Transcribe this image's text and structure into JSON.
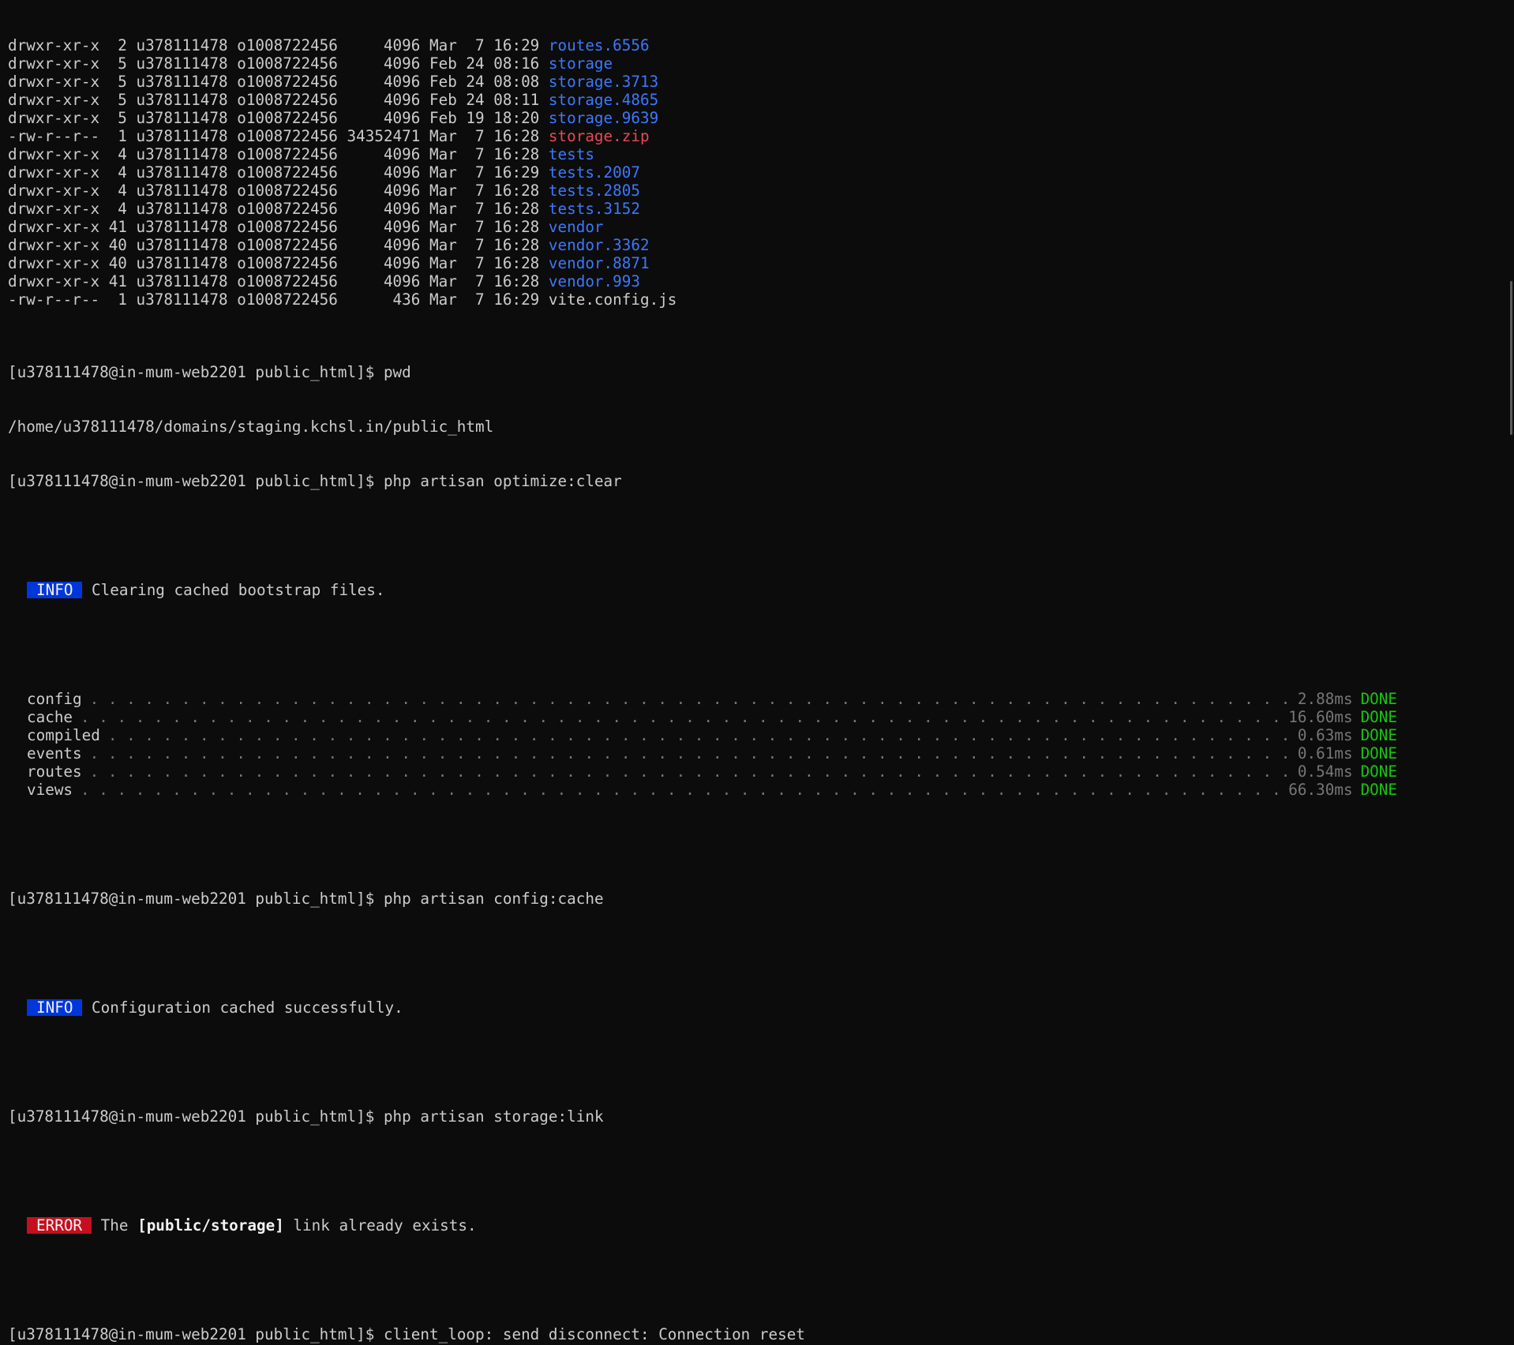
{
  "listing": [
    {
      "perms": "drwxr-xr-x",
      "links": " 2",
      "owner": "u378111478",
      "group": "o1008722456",
      "size": "    4096",
      "date": "Mar  7 16:29",
      "name": "routes.6556",
      "kind": "dir"
    },
    {
      "perms": "drwxr-xr-x",
      "links": " 5",
      "owner": "u378111478",
      "group": "o1008722456",
      "size": "    4096",
      "date": "Feb 24 08:16",
      "name": "storage",
      "kind": "dir"
    },
    {
      "perms": "drwxr-xr-x",
      "links": " 5",
      "owner": "u378111478",
      "group": "o1008722456",
      "size": "    4096",
      "date": "Feb 24 08:08",
      "name": "storage.3713",
      "kind": "dir"
    },
    {
      "perms": "drwxr-xr-x",
      "links": " 5",
      "owner": "u378111478",
      "group": "o1008722456",
      "size": "    4096",
      "date": "Feb 24 08:11",
      "name": "storage.4865",
      "kind": "dir"
    },
    {
      "perms": "drwxr-xr-x",
      "links": " 5",
      "owner": "u378111478",
      "group": "o1008722456",
      "size": "    4096",
      "date": "Feb 19 18:20",
      "name": "storage.9639",
      "kind": "dir"
    },
    {
      "perms": "-rw-r--r--",
      "links": " 1",
      "owner": "u378111478",
      "group": "o1008722456",
      "size": "34352471",
      "date": "Mar  7 16:28",
      "name": "storage.zip",
      "kind": "zip"
    },
    {
      "perms": "drwxr-xr-x",
      "links": " 4",
      "owner": "u378111478",
      "group": "o1008722456",
      "size": "    4096",
      "date": "Mar  7 16:28",
      "name": "tests",
      "kind": "dir"
    },
    {
      "perms": "drwxr-xr-x",
      "links": " 4",
      "owner": "u378111478",
      "group": "o1008722456",
      "size": "    4096",
      "date": "Mar  7 16:29",
      "name": "tests.2007",
      "kind": "dir"
    },
    {
      "perms": "drwxr-xr-x",
      "links": " 4",
      "owner": "u378111478",
      "group": "o1008722456",
      "size": "    4096",
      "date": "Mar  7 16:28",
      "name": "tests.2805",
      "kind": "dir"
    },
    {
      "perms": "drwxr-xr-x",
      "links": " 4",
      "owner": "u378111478",
      "group": "o1008722456",
      "size": "    4096",
      "date": "Mar  7 16:28",
      "name": "tests.3152",
      "kind": "dir"
    },
    {
      "perms": "drwxr-xr-x",
      "links": "41",
      "owner": "u378111478",
      "group": "o1008722456",
      "size": "    4096",
      "date": "Mar  7 16:28",
      "name": "vendor",
      "kind": "dir"
    },
    {
      "perms": "drwxr-xr-x",
      "links": "40",
      "owner": "u378111478",
      "group": "o1008722456",
      "size": "    4096",
      "date": "Mar  7 16:28",
      "name": "vendor.3362",
      "kind": "dir"
    },
    {
      "perms": "drwxr-xr-x",
      "links": "40",
      "owner": "u378111478",
      "group": "o1008722456",
      "size": "    4096",
      "date": "Mar  7 16:28",
      "name": "vendor.8871",
      "kind": "dir"
    },
    {
      "perms": "drwxr-xr-x",
      "links": "41",
      "owner": "u378111478",
      "group": "o1008722456",
      "size": "    4096",
      "date": "Mar  7 16:28",
      "name": "vendor.993",
      "kind": "dir"
    },
    {
      "perms": "-rw-r--r--",
      "links": " 1",
      "owner": "u378111478",
      "group": "o1008722456",
      "size": "     436",
      "date": "Mar  7 16:29",
      "name": "vite.config.js",
      "kind": "plain"
    }
  ],
  "prompt": "[u378111478@in-mum-web2201 public_html]$ ",
  "cmd_pwd": "pwd",
  "pwd_output": "/home/u378111478/domains/staging.kchsl.in/public_html",
  "cmd_optimize": "php artisan optimize:clear",
  "info_label": "INFO",
  "optimize_msg": "Clearing cached bootstrap files.",
  "tasks": [
    {
      "name": "config",
      "time": "2.88ms",
      "status": "DONE"
    },
    {
      "name": "cache",
      "time": "16.60ms",
      "status": "DONE"
    },
    {
      "name": "compiled",
      "time": "0.63ms",
      "status": "DONE"
    },
    {
      "name": "events",
      "time": "0.61ms",
      "status": "DONE"
    },
    {
      "name": "routes",
      "time": "0.54ms",
      "status": "DONE"
    },
    {
      "name": "views",
      "time": "66.30ms",
      "status": "DONE"
    }
  ],
  "cmd_config": "php artisan config:cache",
  "config_msg": "Configuration cached successfully.",
  "cmd_storage": "php artisan storage:link",
  "error_label": "ERROR",
  "error_pre": "The ",
  "error_bold": "[public/storage]",
  "error_post": " link already exists.",
  "last_output": "client_loop: send disconnect: Connection reset"
}
